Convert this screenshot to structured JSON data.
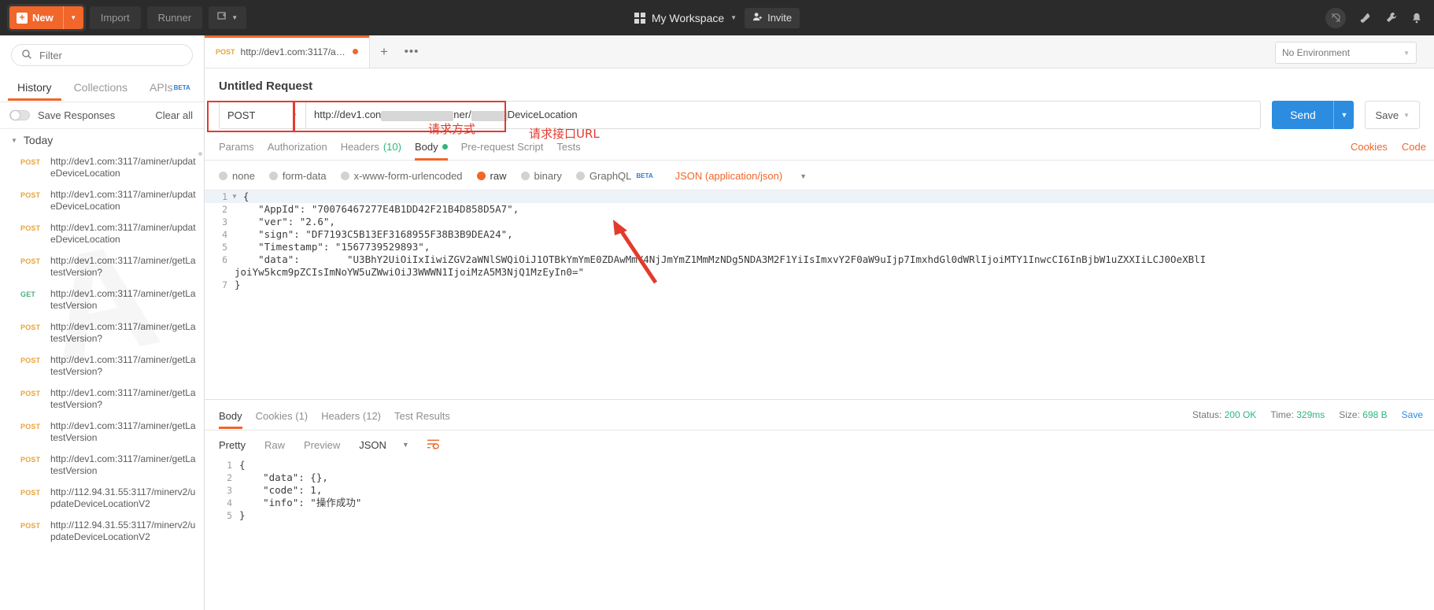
{
  "topbar": {
    "new_label": "New",
    "new_plus_icon": "plus-icon",
    "new_caret_icon": "chevron-down-icon",
    "import_label": "Import",
    "runner_label": "Runner",
    "open_new_icon": "open-new-window-icon",
    "workspace_label": "My Workspace",
    "workspace_caret_icon": "chevron-down-icon",
    "grid_icon": "grid-icon",
    "invite_label": "Invite",
    "invite_icon": "person-add-icon",
    "sync_icon": "sync-off-icon",
    "broadcast_icon": "broadcast-icon",
    "settings_icon": "wrench-icon",
    "bell_icon": "bell-icon"
  },
  "sidebar": {
    "filter_placeholder": "Filter",
    "search_icon": "search-icon",
    "tabs": [
      {
        "label": "History",
        "active": true
      },
      {
        "label": "Collections",
        "active": false
      },
      {
        "label": "APIs",
        "beta": "BETA",
        "active": false
      }
    ],
    "save_responses_label": "Save Responses",
    "clear_all_label": "Clear all",
    "group_label": "Today",
    "group_caret_icon": "triangle-down-icon",
    "history": [
      {
        "method": "POST",
        "url": "http://dev1.com:3117/aminer/updateDeviceLocation"
      },
      {
        "method": "POST",
        "url": "http://dev1.com:3117/aminer/updateDeviceLocation"
      },
      {
        "method": "POST",
        "url": "http://dev1.com:3117/aminer/updateDeviceLocation"
      },
      {
        "method": "POST",
        "url": "http://dev1.com:3117/aminer/getLatestVersion?"
      },
      {
        "method": "GET",
        "url": "http://dev1.com:3117/aminer/getLatestVersion"
      },
      {
        "method": "POST",
        "url": "http://dev1.com:3117/aminer/getLatestVersion?"
      },
      {
        "method": "POST",
        "url": "http://dev1.com:3117/aminer/getLatestVersion?"
      },
      {
        "method": "POST",
        "url": "http://dev1.com:3117/aminer/getLatestVersion?"
      },
      {
        "method": "POST",
        "url": "http://dev1.com:3117/aminer/getLatestVersion"
      },
      {
        "method": "POST",
        "url": "http://dev1.com:3117/aminer/getLatestVersion"
      },
      {
        "method": "POST",
        "url": "http://112.94.31.55:3117/minerv2/updateDeviceLocationV2"
      },
      {
        "method": "POST",
        "url": "http://112.94.31.55:3117/minerv2/updateDeviceLocationV2"
      }
    ]
  },
  "request_tab": {
    "method": "POST",
    "title": "http://dev1.com:3117/aminer/...",
    "unsaved_icon": "unsaved-dot-icon",
    "add_tab_icon": "plus-icon",
    "more_icon": "ellipsis-icon"
  },
  "environment": {
    "selected": "No Environment",
    "caret_icon": "chevron-down-icon"
  },
  "request": {
    "name": "Untitled Request",
    "method": "POST",
    "method_caret_icon": "chevron-down-icon",
    "url_prefix": "http://dev1.con",
    "url_mid": "ner/",
    "url_suffix": "DeviceLocation",
    "send_label": "Send",
    "send_caret_icon": "chevron-down-icon",
    "save_label": "Save",
    "save_caret_icon": "chevron-down-icon",
    "annotations": {
      "method": "请求方式",
      "url": "请求接口URL"
    },
    "tabs": [
      {
        "label": "Params",
        "active": false
      },
      {
        "label": "Authorization",
        "active": false
      },
      {
        "label": "Headers",
        "count": "(10)",
        "active": false
      },
      {
        "label": "Body",
        "active": true,
        "dot": true
      },
      {
        "label": "Pre-request Script",
        "active": false
      },
      {
        "label": "Tests",
        "active": false
      }
    ],
    "cookies_label": "Cookies",
    "code_label": "Code",
    "body_types": [
      {
        "label": "none",
        "selected": false
      },
      {
        "label": "form-data",
        "selected": false
      },
      {
        "label": "x-www-form-urlencoded",
        "selected": false
      },
      {
        "label": "raw",
        "selected": true
      },
      {
        "label": "binary",
        "selected": false
      },
      {
        "label": "GraphQL",
        "beta": "BETA",
        "selected": false
      }
    ],
    "content_type": "JSON (application/json)",
    "content_type_caret_icon": "chevron-down-icon",
    "body_lines": [
      {
        "no": "1",
        "fold": true,
        "text": "{"
      },
      {
        "no": "2",
        "text": "    \"AppId\": \"70076467277E4B1DD42F21B4D858D5A7\","
      },
      {
        "no": "3",
        "text": "    \"ver\": \"2.6\","
      },
      {
        "no": "4",
        "text": "    \"sign\": \"DF7193C5B13EF3168955F38B3B9DEA24\","
      },
      {
        "no": "5",
        "text": "    \"Timestamp\": \"1567739529893\","
      },
      {
        "no": "6",
        "text": "    \"data\":        \"U3BhY2UiOiIxIiwiZGV2aWNlSWQiOiJ1OTBkYmYmE0ZDAwMmY4NjJmYmZ1MmMzNDg5NDA3M2F1YiIsImxvY2F0aW9uIjp7ImxhdGl0dWRlIjoiMTY1InwcCI6InBjbW1uZXXIiLCJ0OeXBlIjoiYw5kcm9pZCIsImNoYW5uZWwiOiJ3WWWN1IjoiMzA5M3NjQ1MzEyIn0=\""
      },
      {
        "no": "7",
        "text": "}"
      }
    ]
  },
  "response": {
    "tabs": [
      {
        "label": "Body",
        "active": true
      },
      {
        "label": "Cookies",
        "count": "(1)",
        "active": false
      },
      {
        "label": "Headers",
        "count": "(12)",
        "active": false
      },
      {
        "label": "Test Results",
        "active": false
      }
    ],
    "status_label": "Status:",
    "status_value": "200 OK",
    "time_label": "Time:",
    "time_value": "329ms",
    "size_label": "Size:",
    "size_value": "698 B",
    "save_response_label": "Save",
    "view_modes": [
      {
        "label": "Pretty",
        "active": true
      },
      {
        "label": "Raw",
        "active": false
      },
      {
        "label": "Preview",
        "active": false
      }
    ],
    "format": "JSON",
    "format_caret_icon": "chevron-down-icon",
    "wrap_icon": "word-wrap-icon",
    "body_lines": [
      {
        "no": "1",
        "text": "{"
      },
      {
        "no": "2",
        "text": "    \"data\": {},"
      },
      {
        "no": "3",
        "text": "    \"code\": 1,"
      },
      {
        "no": "4",
        "text": "    \"info\": \"操作成功\""
      },
      {
        "no": "5",
        "text": "}"
      }
    ]
  },
  "colors": {
    "accent": "#f1662a",
    "send": "#2b8ce0",
    "success": "#2fb67c",
    "annotation": "#e23b2e",
    "post": "#e8a33d",
    "get": "#4caf7d"
  }
}
